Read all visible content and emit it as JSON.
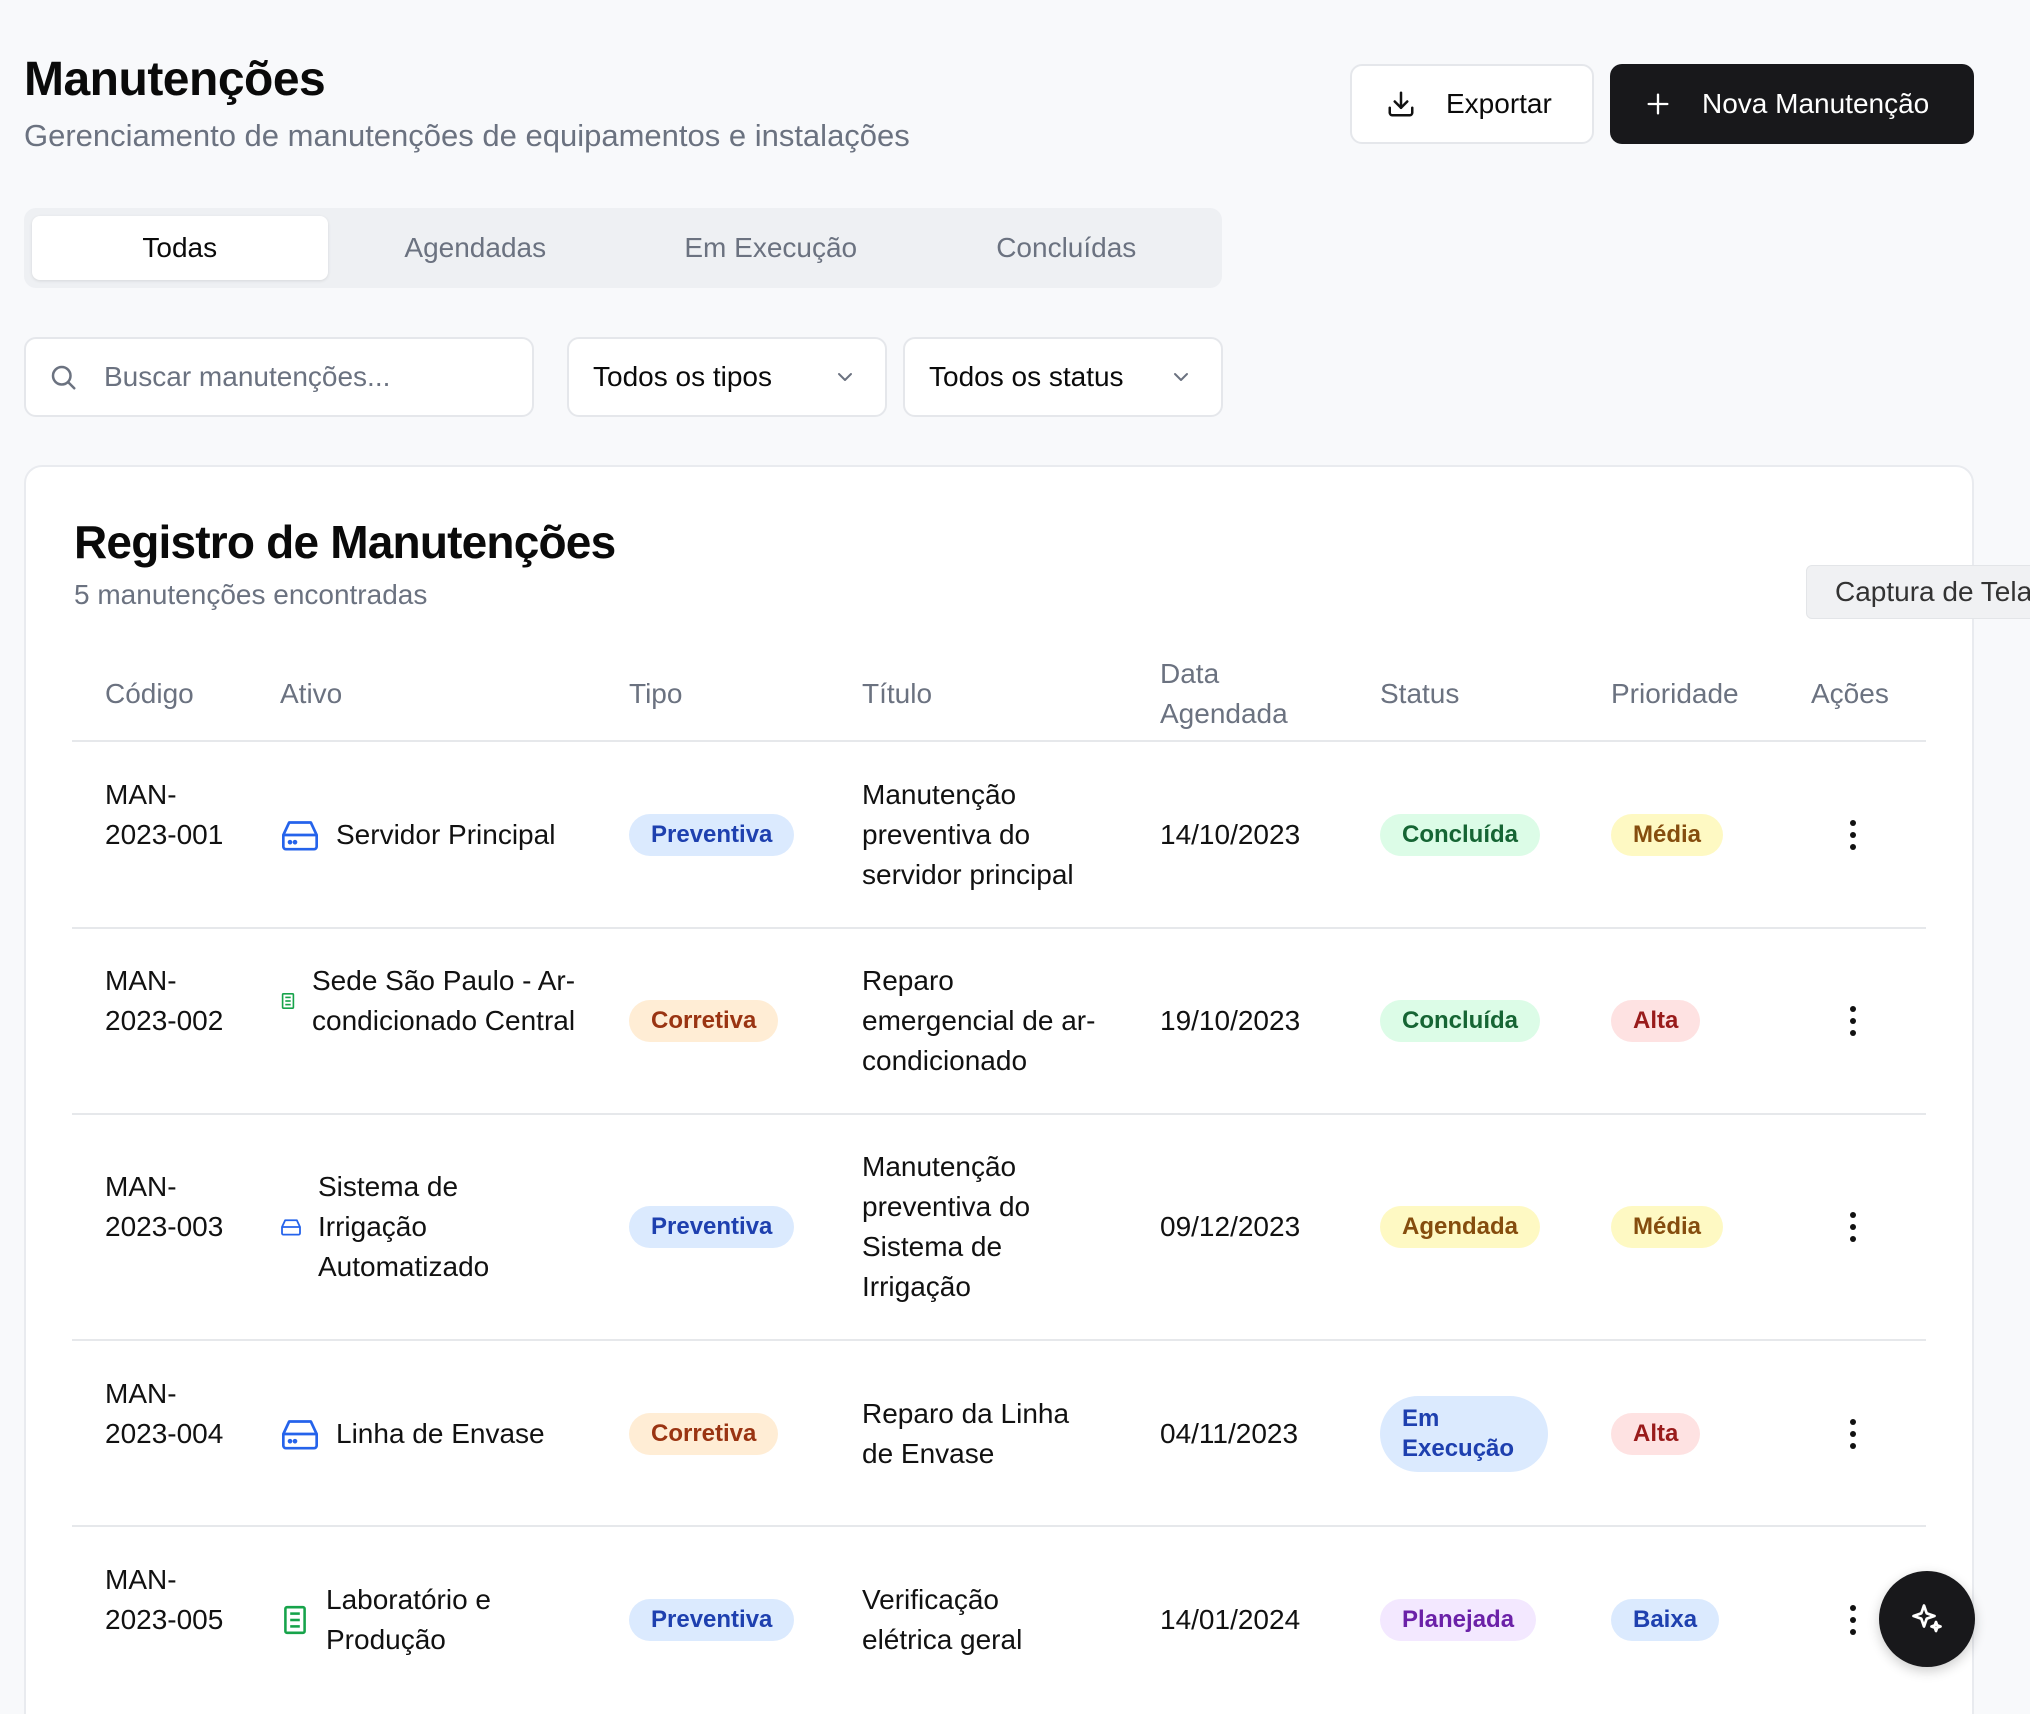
{
  "header": {
    "title": "Manutenções",
    "subtitle": "Gerenciamento de manutenções de equipamentos e instalações",
    "export_label": "Exportar",
    "new_label": "Nova Manutenção"
  },
  "tabs": [
    {
      "label": "Todas",
      "active": true
    },
    {
      "label": "Agendadas",
      "active": false
    },
    {
      "label": "Em Execução",
      "active": false
    },
    {
      "label": "Concluídas",
      "active": false
    }
  ],
  "filters": {
    "search_placeholder": "Buscar manutenções...",
    "type_select": "Todos os tipos",
    "status_select": "Todos os status"
  },
  "card": {
    "title": "Registro de Manutenções",
    "count_text": "5 manutenções encontradas"
  },
  "tooltip": "Captura de Tela",
  "table": {
    "columns": [
      "Código",
      "Ativo",
      "Tipo",
      "Título",
      "Data Agendada",
      "Status",
      "Prioridade",
      "Ações"
    ],
    "rows": [
      {
        "code": "MAN-2023-001",
        "asset": "Servidor Principal",
        "asset_icon": "server-icon",
        "type": "Preventiva",
        "title": "Manutenção preventiva do servidor principal",
        "date": "14/10/2023",
        "status": "Concluída",
        "priority": "Média"
      },
      {
        "code": "MAN-2023-002",
        "asset": "Sede São Paulo - Ar-condicionado Central",
        "asset_icon": "building-icon",
        "type": "Corretiva",
        "title": "Reparo emergencial de ar-condicionado",
        "date": "19/10/2023",
        "status": "Concluída",
        "priority": "Alta"
      },
      {
        "code": "MAN-2023-003",
        "asset": "Sistema de Irrigação Automatizado",
        "asset_icon": "server-icon",
        "type": "Preventiva",
        "title": "Manutenção preventiva do Sistema de Irrigação",
        "date": "09/12/2023",
        "status": "Agendada",
        "priority": "Média"
      },
      {
        "code": "MAN-2023-004",
        "asset": "Linha de Envase",
        "asset_icon": "server-icon",
        "type": "Corretiva",
        "title": "Reparo da Linha de Envase",
        "date": "04/11/2023",
        "status": "Em Execução",
        "priority": "Alta"
      },
      {
        "code": "MAN-2023-005",
        "asset": "Laboratório e Produção",
        "asset_icon": "building-icon",
        "type": "Preventiva",
        "title": "Verificação elétrica geral",
        "date": "14/01/2024",
        "status": "Planejada",
        "priority": "Baixa"
      }
    ]
  },
  "colors": {
    "primary_button": "#18181b",
    "server_icon": "#2563eb",
    "building_icon": "#16a34a"
  }
}
